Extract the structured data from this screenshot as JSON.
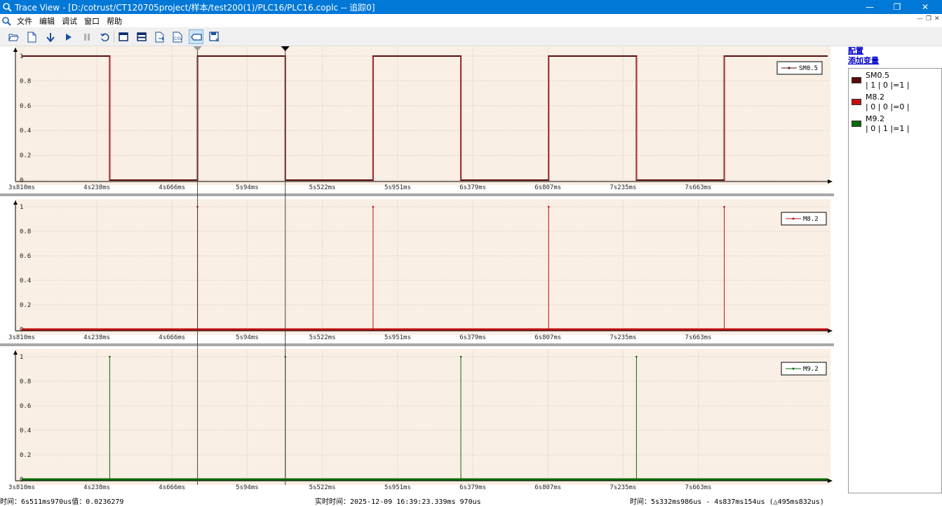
{
  "window": {
    "title": "Trace View - [D:/cotrust/CT120705project/样本/test200(1)/PLC16/PLC16.coplc -- 追踪0]"
  },
  "menu": [
    "文件",
    "编辑",
    "调试",
    "窗口",
    "帮助"
  ],
  "toolbar": [
    "open-icon",
    "new-icon",
    "download-icon",
    "play-icon",
    "pause-icon",
    "refresh-icon",
    "single-view-icon",
    "split-view-icon",
    "export-icon",
    "csv-icon",
    "marker-icon",
    "save-icon"
  ],
  "right_panel": {
    "config_link": "配置",
    "add_var_link": "添加变量",
    "variables": [
      {
        "name": "SM0.5",
        "values": "| 1 | 0 |=1 |",
        "color": "#5a0a0a"
      },
      {
        "name": "M8.2",
        "values": "| 0 | 0 |=0 |",
        "color": "#c01010"
      },
      {
        "name": "M9.2",
        "values": "| 0 | 1 |=1 |",
        "color": "#0a6a0a"
      }
    ]
  },
  "status": {
    "left": "时间：6s511ms970us值：0.0236279",
    "center": "实时时间：2025-12-09 16:39:23.339ms 970us",
    "right": "时间：5s332ms986us - 4s837ms154us (△495ms832us)"
  },
  "chart_data": [
    {
      "type": "line",
      "series": [
        {
          "name": "SM0.5",
          "color": "#5a0a0a"
        }
      ],
      "x": [
        "3s810ms",
        "4s238ms",
        "4s666ms",
        "5s94ms",
        "5s522ms",
        "5s951ms",
        "6s379ms",
        "6s807ms",
        "7s235ms",
        "7s663ms"
      ],
      "x_ms": [
        3810,
        4238,
        4666,
        5094,
        5522,
        5951,
        6379,
        6807,
        7235,
        7663
      ],
      "y_ticks": [
        "0",
        "0.2",
        "0.4",
        "0.6",
        "0.8",
        "1"
      ],
      "xlim_ms": [
        3810,
        8400
      ],
      "ylim": [
        0,
        1
      ],
      "steps": [
        [
          3810,
          1
        ],
        [
          4311,
          0
        ],
        [
          4811,
          1
        ],
        [
          5311,
          0
        ],
        [
          5811,
          1
        ],
        [
          6311,
          0
        ],
        [
          6811,
          1
        ],
        [
          7311,
          0
        ],
        [
          7811,
          1
        ],
        [
          8400,
          1
        ]
      ],
      "legend": "SM0.5",
      "legend_position": "top-right",
      "grid": true
    },
    {
      "type": "line",
      "series": [
        {
          "name": "M8.2",
          "color": "#c01010"
        }
      ],
      "x": [
        "3s810ms",
        "4s238ms",
        "4s666ms",
        "5s94ms",
        "5s522ms",
        "5s951ms",
        "6s379ms",
        "6s807ms",
        "7s235ms",
        "7s663ms"
      ],
      "x_ms": [
        3810,
        4238,
        4666,
        5094,
        5522,
        5951,
        6379,
        6807,
        7235,
        7663
      ],
      "y_ticks": [
        "0",
        "0.2",
        "0.4",
        "0.6",
        "0.8",
        "1"
      ],
      "xlim_ms": [
        3810,
        8400
      ],
      "ylim": [
        0,
        1
      ],
      "pulses_ms": [
        4811,
        5811,
        6811,
        7811
      ],
      "legend": "M8.2",
      "legend_position": "top-right",
      "grid": true
    },
    {
      "type": "line",
      "series": [
        {
          "name": "M9.2",
          "color": "#0a6a0a"
        }
      ],
      "x": [
        "3s810ms",
        "4s238ms",
        "4s666ms",
        "5s94ms",
        "5s522ms",
        "5s951ms",
        "6s379ms",
        "6s807ms",
        "7s235ms",
        "7s663ms"
      ],
      "x_ms": [
        3810,
        4238,
        4666,
        5094,
        5522,
        5951,
        6379,
        6807,
        7235,
        7663
      ],
      "y_ticks": [
        "0",
        "0.2",
        "0.4",
        "0.6",
        "0.8",
        "1"
      ],
      "xlim_ms": [
        3810,
        8400
      ],
      "ylim": [
        0,
        1
      ],
      "pulses_ms": [
        4311,
        5311,
        6311,
        7311
      ],
      "legend": "M9.2",
      "legend_position": "top-right",
      "grid": true
    }
  ],
  "cursors_ms": [
    4811,
    5311
  ]
}
